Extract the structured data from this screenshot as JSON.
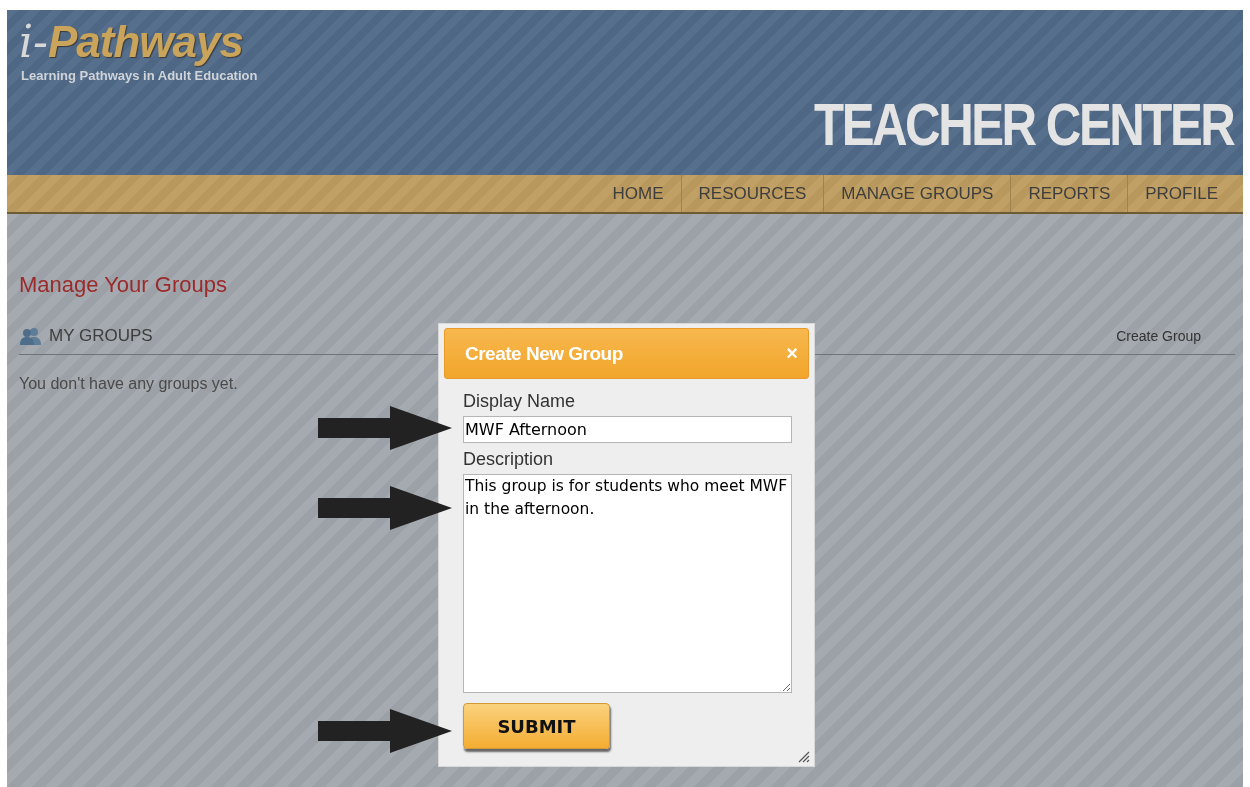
{
  "header": {
    "logo_prefix": "i-",
    "logo_name": "Pathways",
    "tagline": "Learning Pathways in Adult Education",
    "title": "TEACHER CENTER"
  },
  "nav": [
    "HOME",
    "RESOURCES",
    "MANAGE GROUPS",
    "REPORTS",
    "PROFILE"
  ],
  "page": {
    "heading": "Manage Your Groups",
    "section_title": "MY GROUPS",
    "action": "Create Group",
    "empty_message": "You don't have any groups yet."
  },
  "dialog": {
    "title": "Create New Group",
    "close": "×",
    "fields": [
      {
        "kind": "input",
        "label": "Display Name",
        "value": "MWF Afternoon"
      },
      {
        "kind": "textarea",
        "label": "Description",
        "value": "This group is for students who meet MWF in the afternoon."
      }
    ],
    "submit": "SUBMIT"
  }
}
